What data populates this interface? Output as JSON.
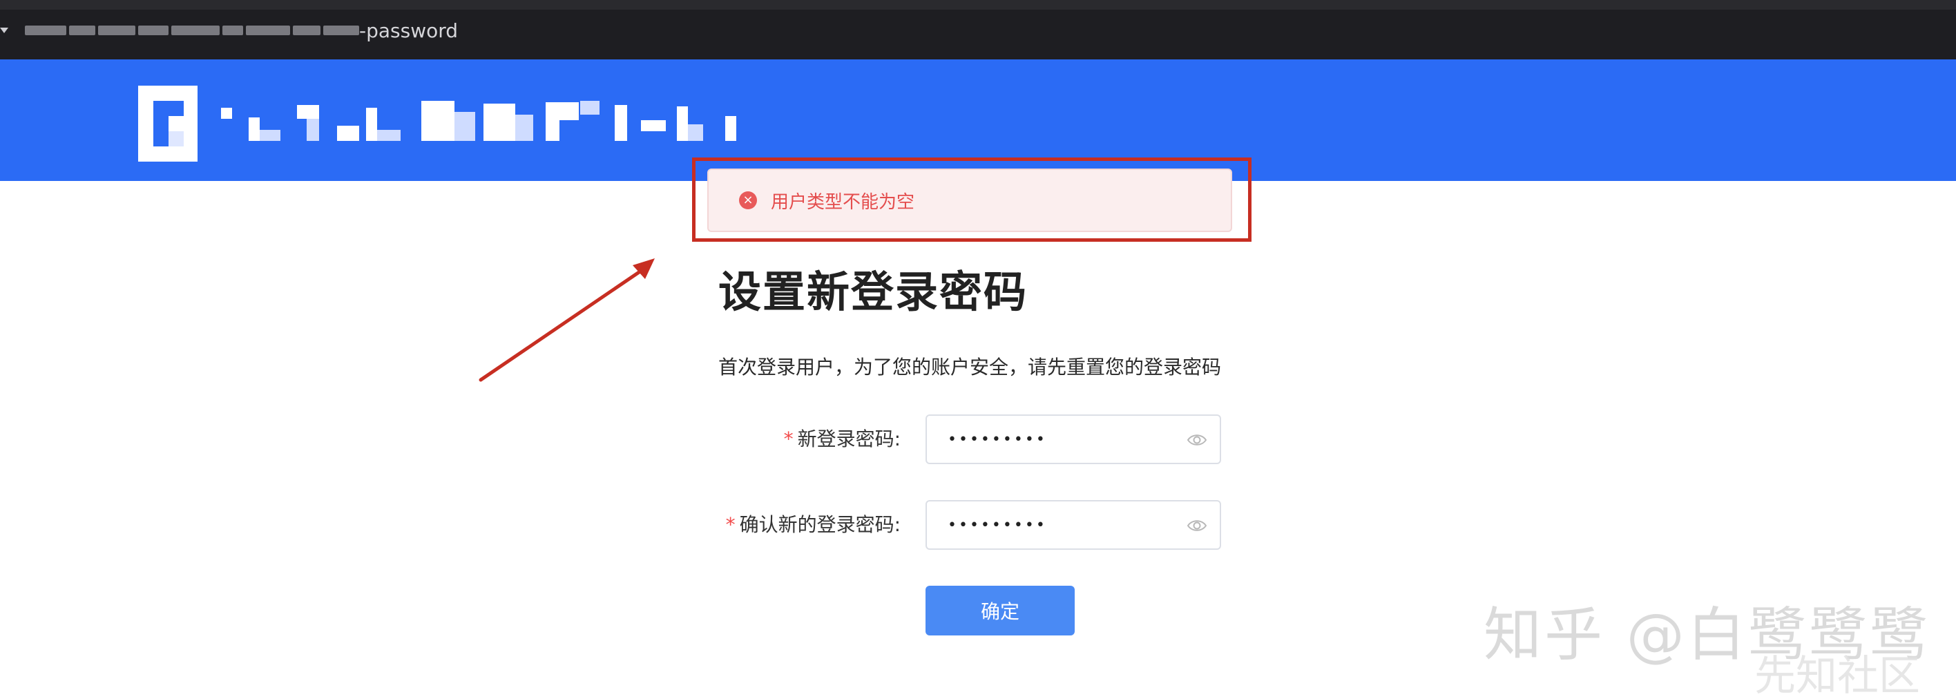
{
  "browser": {
    "url_visible_suffix": "-password"
  },
  "toast": {
    "icon": "error-circle-icon",
    "message": "用户类型不能为空"
  },
  "form": {
    "title": "设置新登录密码",
    "subtitle": "首次登录用户，为了您的账户安全，请先重置您的登录密码",
    "fields": [
      {
        "required_mark": "*",
        "label": "新登录密码:",
        "value": "•••••••••",
        "icon": "eye-icon"
      },
      {
        "required_mark": "*",
        "label": "确认新的登录密码:",
        "value": "•••••••••",
        "icon": "eye-icon"
      }
    ],
    "submit_label": "确定"
  },
  "watermarks": {
    "zhihu": "知乎 @白鹭鹭鹭",
    "xianzhi": "先知社区"
  },
  "colors": {
    "header_blue": "#2b6bf5",
    "toast_bg": "#fbeeee",
    "toast_text": "#e44d4d",
    "annotation_red": "#c72e22",
    "button_blue": "#4a8af4"
  }
}
